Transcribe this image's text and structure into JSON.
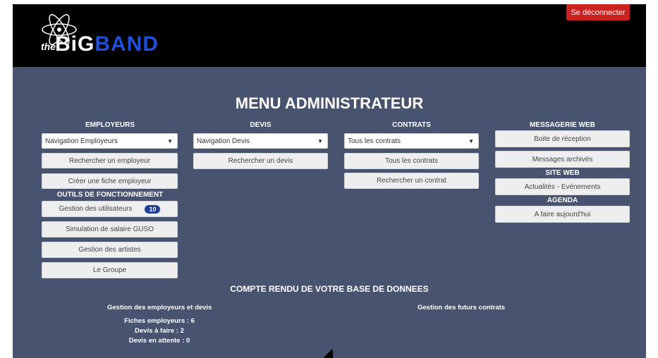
{
  "header": {
    "logo": {
      "the": "the",
      "big": "BiG",
      "band": "BAND"
    },
    "logout_label": "Se déconnecter"
  },
  "page_title": "MENU ADMINISTRATEUR",
  "employeurs": {
    "heading": "EMPLOYEURS",
    "select_value": "Navigation Employeurs",
    "search_label": "Rechercher un employeur",
    "create_label": "Créer une fiche employeur"
  },
  "outils": {
    "heading": "OUTILS DE FONCTIONNEMENT",
    "users_label": "Gestion des utilisateurs",
    "users_badge": "10",
    "guso_label": "Simulation de salaire GUSO",
    "artists_label": "Gestion des artistes",
    "group_label": "Le Groupe"
  },
  "devis": {
    "heading": "DEVIS",
    "select_value": "Navigation Devis",
    "search_label": "Rechercher un devis"
  },
  "contrats": {
    "heading": "CONTRATS",
    "select_value": "Tous les contrats",
    "all_label": "Tous les contrats",
    "search_label": "Rechercher un contrat"
  },
  "messagerie": {
    "heading": "MESSAGERIE WEB",
    "inbox_label": "Boite de réception",
    "archived_label": "Messages archivés"
  },
  "site_web": {
    "heading": "SITE WEB",
    "news_label": "Actualités - Evènements"
  },
  "agenda": {
    "heading": "AGENDA",
    "today_label": "A faire aujourd'hui"
  },
  "report": {
    "title": "COMPTE RENDU DE VOTRE BASE DE DONNEES",
    "left_title": "Gestion des employeurs et devis",
    "right_title": "Gestion des futurs contrats",
    "stats": [
      "Fiches employeurs : 6",
      "Devis à faire : 2",
      "Devis en attente : 0"
    ]
  },
  "colors": {
    "background": "#48546f",
    "topbar": "#000000",
    "logout": "#c9221f",
    "badge": "#1f3e9c",
    "brand_blue": "#1f4fd6"
  }
}
